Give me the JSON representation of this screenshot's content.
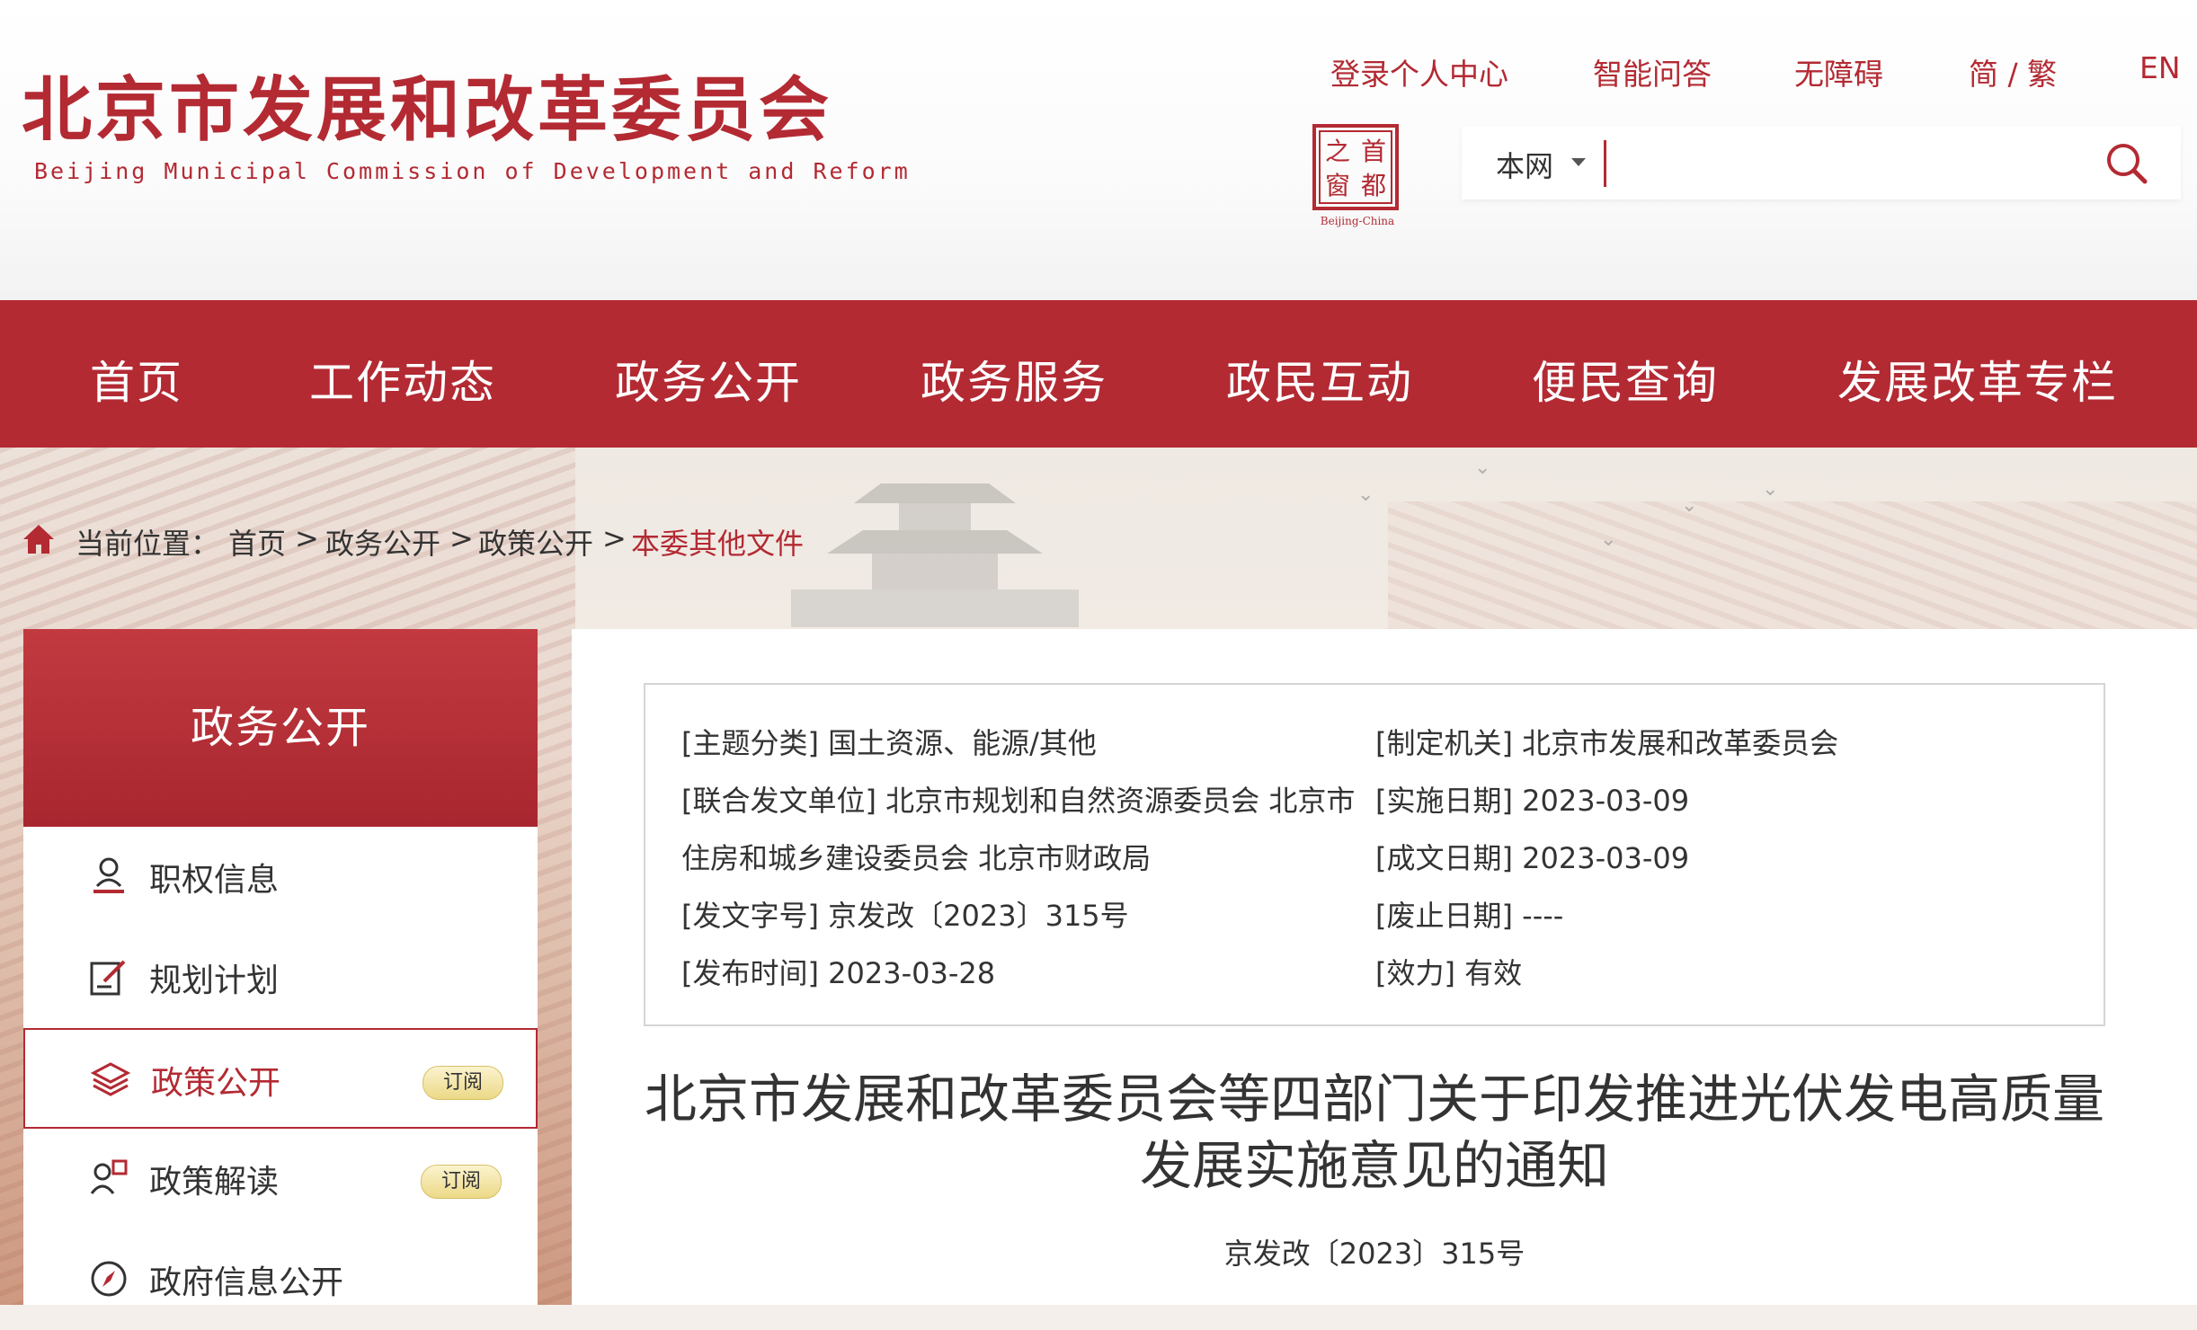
{
  "header": {
    "logo_cn": "北京市发展和改革委员会",
    "logo_en": "Beijing Municipal Commission of Development and Reform",
    "seal_text": [
      "之",
      "首",
      "窗",
      "都"
    ],
    "seal_caption": "Beijing-China",
    "top_links": [
      "登录个人中心",
      "智能问答",
      "无障碍",
      "简 / 繁",
      "EN"
    ],
    "search": {
      "scope": "本网",
      "value": "",
      "placeholder": ""
    }
  },
  "nav": {
    "items": [
      "首页",
      "工作动态",
      "政务公开",
      "政务服务",
      "政民互动",
      "便民查询",
      "发展改革专栏"
    ]
  },
  "breadcrumb": {
    "label": "当前位置：",
    "items": [
      "首页",
      "政务公开",
      "政策公开",
      "本委其他文件"
    ],
    "separator": ">"
  },
  "sidebar": {
    "title": "政务公开",
    "items": [
      {
        "label": "职权信息",
        "icon": "user-stamp-icon",
        "subscribe": ""
      },
      {
        "label": "规划计划",
        "icon": "edit-document-icon",
        "subscribe": ""
      },
      {
        "label": "政策公开",
        "icon": "layers-icon",
        "subscribe": "订阅"
      },
      {
        "label": "政策解读",
        "icon": "person-chat-icon",
        "subscribe": "订阅"
      },
      {
        "label": "政府信息公开",
        "icon": "compass-icon",
        "subscribe": ""
      }
    ]
  },
  "document": {
    "meta": {
      "topic": "[主题分类] 国土资源、能源/其他",
      "joint_1": "[联合发文单位] 北京市规划和自然资源委员会 北京市",
      "joint_2": "住房和城乡建设委员会 北京市财政局",
      "doc_no": "[发文字号] 京发改〔2023〕315号",
      "publish": "[发布时间] 2023-03-28",
      "issuer": "[制定机关] 北京市发展和改革委员会",
      "effective": "[实施日期] 2023-03-09",
      "written": "[成文日期] 2023-03-09",
      "abolish": "[废止日期] ----",
      "validity": "[效力] 有效"
    },
    "title": "北京市发展和改革委员会等四部门关于印发推进光伏发电高质量发展实施意见的通知",
    "number": "京发改〔2023〕315号"
  },
  "colors": {
    "brand_red": "#b32a33",
    "subscribe_yellow": "#ecd987"
  }
}
